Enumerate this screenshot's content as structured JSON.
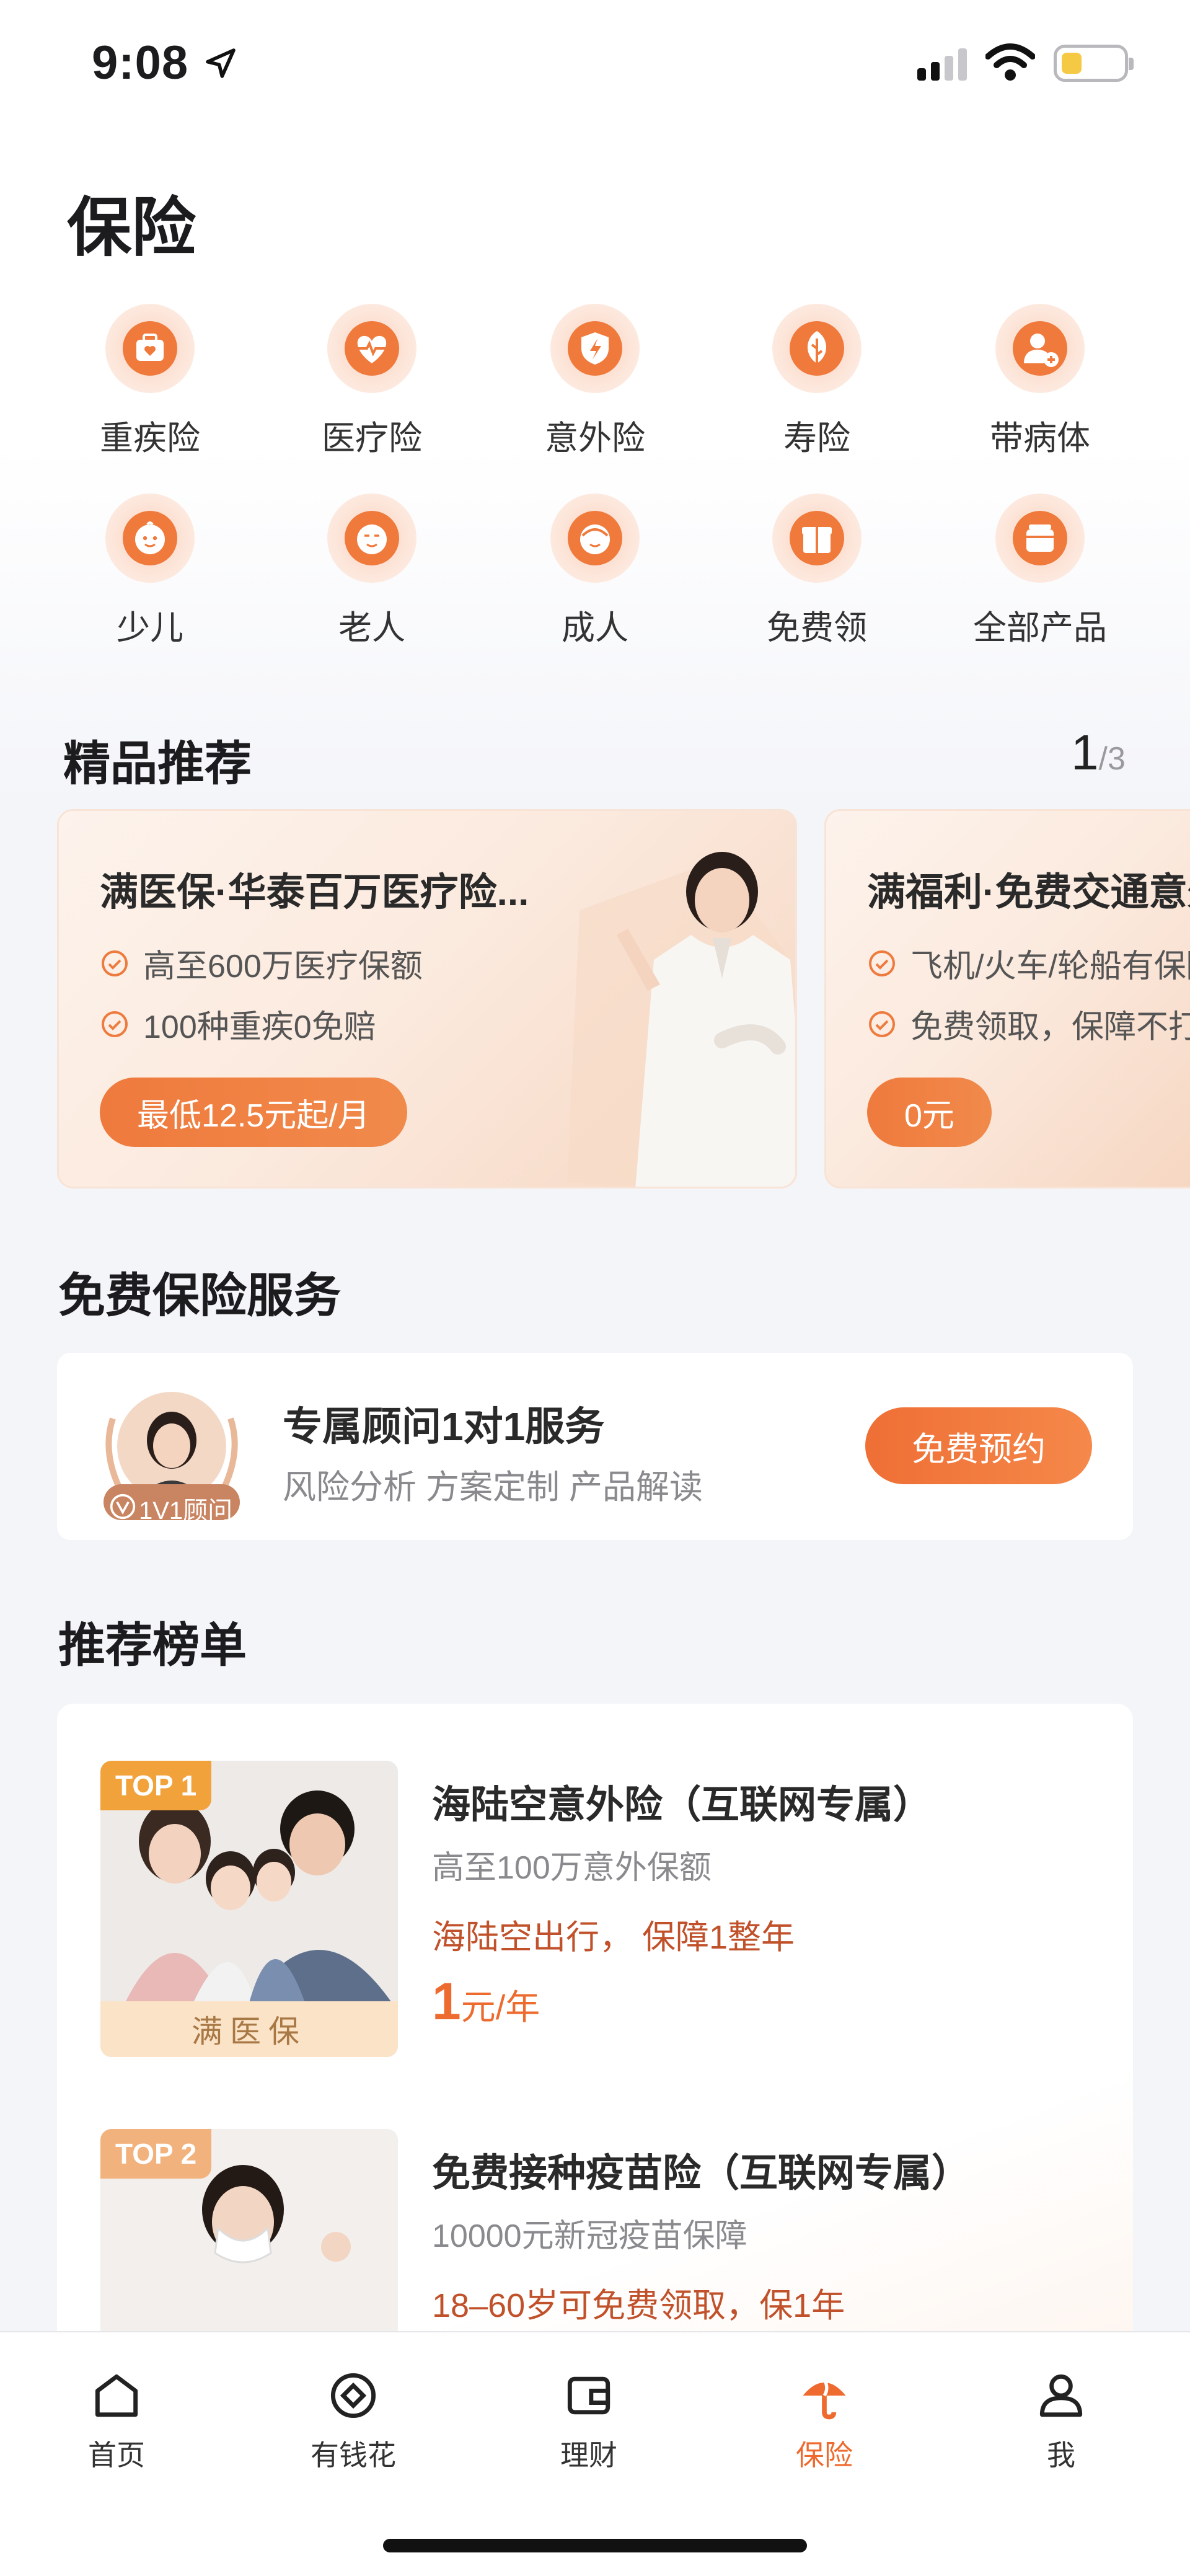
{
  "status_bar": {
    "time": "9:08"
  },
  "page_title": "保险",
  "categories": [
    {
      "label": "重疾险",
      "icon": "medical-bag-icon"
    },
    {
      "label": "医疗险",
      "icon": "heartbeat-icon"
    },
    {
      "label": "意外险",
      "icon": "shield-bolt-icon"
    },
    {
      "label": "寿险",
      "icon": "leaf-icon"
    },
    {
      "label": "带病体",
      "icon": "person-plus-icon"
    },
    {
      "label": "少儿",
      "icon": "child-face-icon"
    },
    {
      "label": "老人",
      "icon": "elder-face-icon"
    },
    {
      "label": "成人",
      "icon": "adult-face-icon"
    },
    {
      "label": "免费领",
      "icon": "gift-icon"
    },
    {
      "label": "全部产品",
      "icon": "box-icon"
    }
  ],
  "featured": {
    "title": "精品推荐",
    "pager_current": "1",
    "pager_total": "/3",
    "cards": [
      {
        "title": "满医保·华泰百万医疗险...",
        "features": [
          "高至600万医疗保额",
          "100种重疾0免赔"
        ],
        "cta": "最低12.5元起/月"
      },
      {
        "title": "满福利·免费交通意外险",
        "features": [
          "飞机/火车/轮船有保障",
          "免费领取，保障不打折"
        ],
        "cta": "0元"
      }
    ]
  },
  "free_service": {
    "title": "免费保险服务",
    "advisor_badge": "1V1顾问",
    "advisor_title": "专属顾问1对1服务",
    "advisor_subtitle": "风险分析 方案定制 产品解读",
    "button": "免费预约"
  },
  "ranking": {
    "title": "推荐榜单",
    "items": [
      {
        "badge": "TOP 1",
        "thumb_footer": "满医保",
        "title": "海陆空意外险（互联网专属）",
        "subtitle": "高至100万意外保额",
        "note": "海陆空出行， 保障1整年",
        "price": "1",
        "price_unit": "元/年"
      },
      {
        "badge": "TOP 2",
        "title": "免费接种疫苗险（互联网专属）",
        "subtitle": "10000元新冠疫苗保障",
        "note": "18–60岁可免费领取，保1年"
      }
    ]
  },
  "tabbar": [
    {
      "label": "首页",
      "icon": "home-icon"
    },
    {
      "label": "有钱花",
      "icon": "coin-icon"
    },
    {
      "label": "理财",
      "icon": "wallet-icon"
    },
    {
      "label": "保险",
      "icon": "umbrella-icon",
      "active": true
    },
    {
      "label": "我",
      "icon": "user-icon"
    }
  ],
  "colors": {
    "accent": "#EF6A2E",
    "cta_orange": "#F08A4B",
    "badge_gold": "#F2A23B"
  }
}
